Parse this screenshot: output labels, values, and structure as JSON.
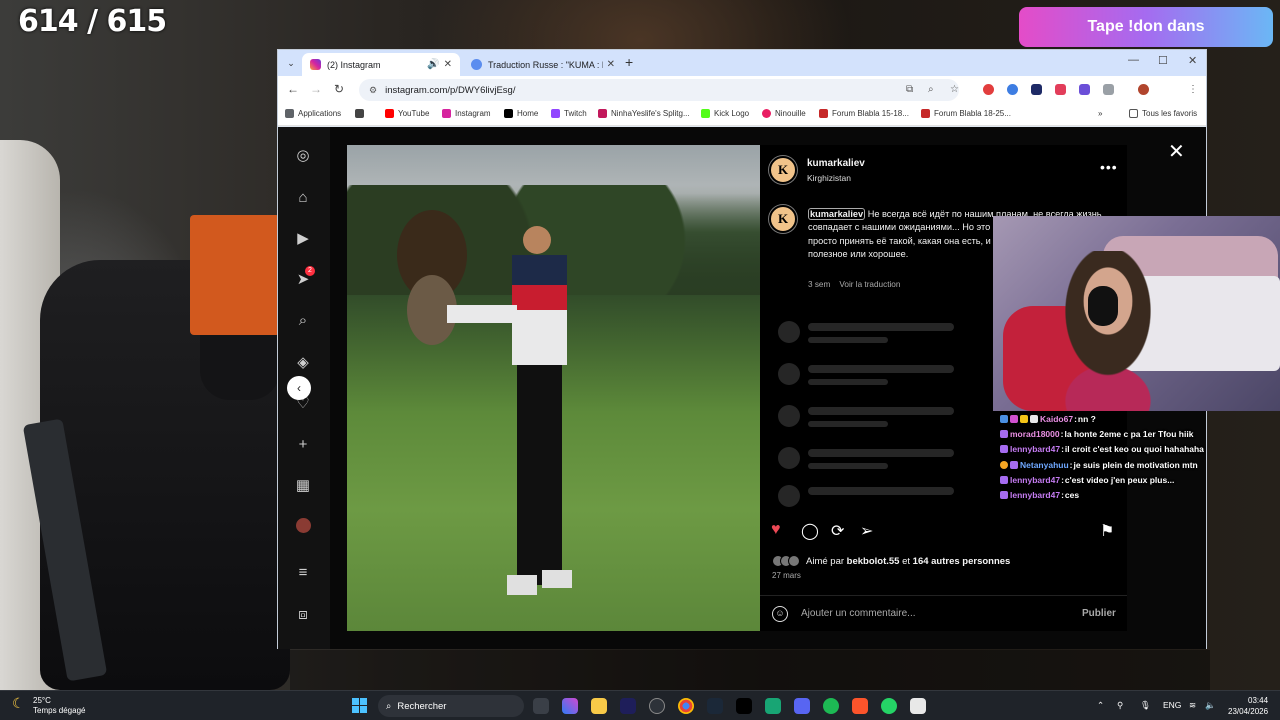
{
  "overlay": {
    "counter": "614 / 615",
    "donation_banner": "Tape !don dans"
  },
  "browser": {
    "tabs": [
      {
        "label": "(2) Instagram",
        "active": true
      },
      {
        "label": "Traduction Russe : \"KUMA : Là",
        "active": false
      }
    ],
    "url": "instagram.com/p/DWY6livjEsg/",
    "bookmarks": [
      "Applications",
      "YouTube",
      "Instagram",
      "Home",
      "Twitch",
      "NinhaYeslife's Splitg...",
      "Kick Logo",
      "Ninouille",
      "Forum Blabla 15-18...",
      "Forum Blabla 18-25..."
    ],
    "all_bookmarks": "Tous les favoris"
  },
  "instagram": {
    "username": "kumarkaliev",
    "location": "Kirghizistan",
    "caption_user": "kumarkaliev",
    "caption_text": "Не всегда всё идёт по нашим планам, не всегда жизнь совпадает с нашими ожиданиями... Но это и есть жизнь. Иногда нужно просто принять её такой, какая она есть, и постараться увидеть в ней полезное или хорошее.",
    "time_ago": "3 sem",
    "translate": "Voir la traduction",
    "liked_by_prefix": "Aimé par ",
    "liked_by_user": "bekbolot.55",
    "liked_by_suffix": " et ",
    "liked_by_others": "164 autres personnes",
    "date": "27 mars",
    "comment_placeholder": "Ajouter un commentaire...",
    "publish": "Publier",
    "notification_badge": "2"
  },
  "chat": [
    {
      "user": "Kaido67",
      "color": "#e98fe3",
      "text": "nn ?"
    },
    {
      "user": "morad18000",
      "color": "#e98fe3",
      "text": "la honte 2eme c pa 1er Tfou hiik"
    },
    {
      "user": "lennybard47",
      "color": "#c57cf2",
      "text": "il croit c'est keo ou quoi hahahaha"
    },
    {
      "user": "Netanyahuu",
      "color": "#6fa8ff",
      "text": "je suis plein de motivation mtn"
    },
    {
      "user": "lennybard47",
      "color": "#c57cf2",
      "text": "c'est video j'en peux plus..."
    },
    {
      "user": "lennybard47",
      "color": "#c57cf2",
      "text": "ces"
    }
  ],
  "taskbar": {
    "temperature": "25°C",
    "weather": "Temps dégagé",
    "search": "Rechercher",
    "language": "ENG",
    "time": "03:44",
    "date": "23/04/2026"
  },
  "colors": {
    "accent_like": "#ed4956",
    "banner_start": "#e44cc8",
    "banner_end": "#6bb7f5",
    "windows_blue": "#4cc2ff"
  }
}
